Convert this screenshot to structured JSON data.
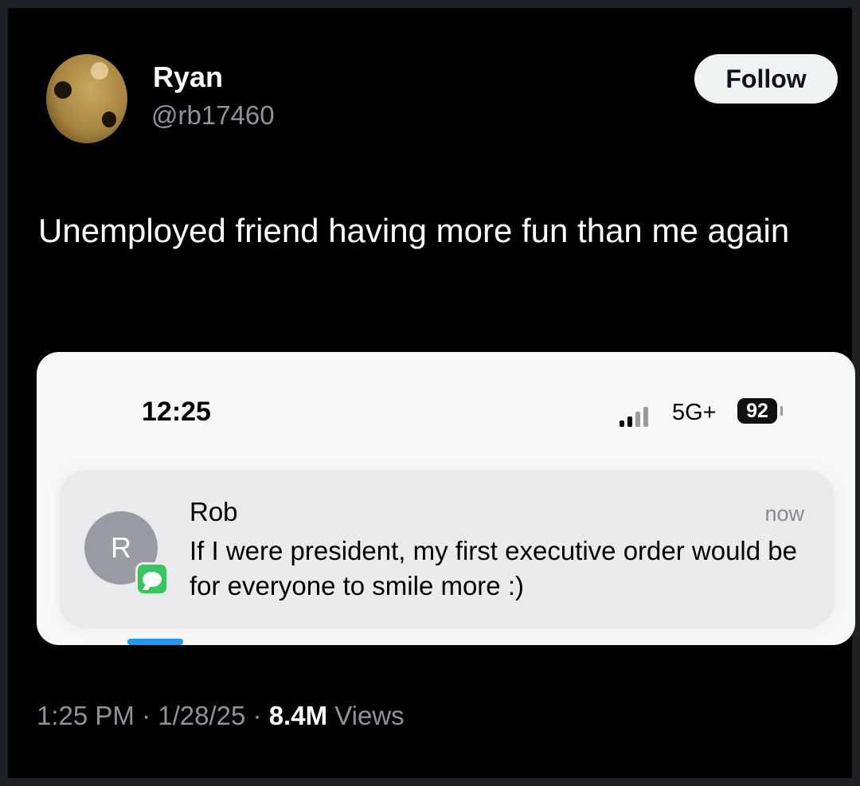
{
  "tweet": {
    "display_name": "Ryan",
    "handle": "@rb17460",
    "follow_label": "Follow",
    "text": "Unemployed friend having more fun than me again",
    "time": "1:25 PM",
    "separator": "·",
    "date": "1/28/25",
    "views_count": "8.4M",
    "views_label": "Views"
  },
  "screenshot": {
    "status_time": "12:25",
    "network": "5G+",
    "battery": "92",
    "notification": {
      "contact_initial": "R",
      "sender": "Rob",
      "time": "now",
      "message": "If I were president, my first executive order would be for everyone to smile more :)"
    }
  },
  "colors": {
    "background": "#000000",
    "follow_button": "#eff3f4",
    "muted_text": "#8b949b",
    "messages_green": "#34c759",
    "accent_blue": "#1d9bf0"
  }
}
